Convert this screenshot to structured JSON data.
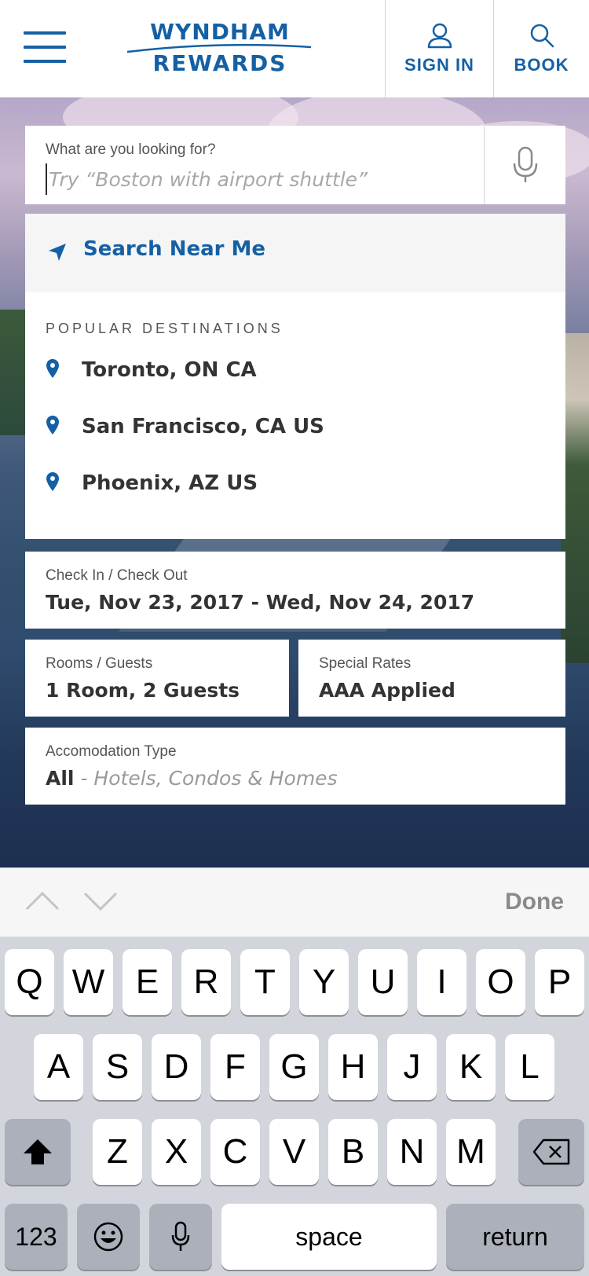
{
  "header": {
    "logo_line1": "WYNDHAM",
    "logo_line2": "REWARDS",
    "sign_in_label": "SIGN IN",
    "book_label": "BOOK",
    "brand_color": "#1560a5"
  },
  "search": {
    "caption": "What are you looking for?",
    "placeholder": "Try “Boston with airport shuttle”",
    "value": ""
  },
  "dropdown": {
    "near_me_label": "Search Near Me",
    "popular_heading": "POPULAR DESTINATIONS",
    "destinations": [
      {
        "label": "Toronto, ON CA"
      },
      {
        "label": "San Francisco, CA US"
      },
      {
        "label": "Phoenix, AZ US"
      }
    ]
  },
  "dates": {
    "caption": "Check In / Check Out",
    "check_in": "Tue, Nov 23, 2017",
    "separator": " - ",
    "check_out": "Wed, Nov 24, 2017"
  },
  "rooms": {
    "caption": "Rooms / Guests",
    "value": "1 Room, 2 Guests"
  },
  "rates": {
    "caption": "Special Rates",
    "value": "AAA Applied"
  },
  "accommodation": {
    "caption": "Accomodation Type",
    "value": "All",
    "separator": " - ",
    "sub": "Hotels, Condos & Homes"
  },
  "keyboard_bar": {
    "done_label": "Done"
  },
  "keyboard": {
    "row1": [
      "Q",
      "W",
      "E",
      "R",
      "T",
      "Y",
      "U",
      "I",
      "O",
      "P"
    ],
    "row2": [
      "A",
      "S",
      "D",
      "F",
      "G",
      "H",
      "J",
      "K",
      "L"
    ],
    "row3": [
      "Z",
      "X",
      "C",
      "V",
      "B",
      "N",
      "M"
    ],
    "numbers_label": "123",
    "space_label": "space",
    "return_label": "return"
  }
}
